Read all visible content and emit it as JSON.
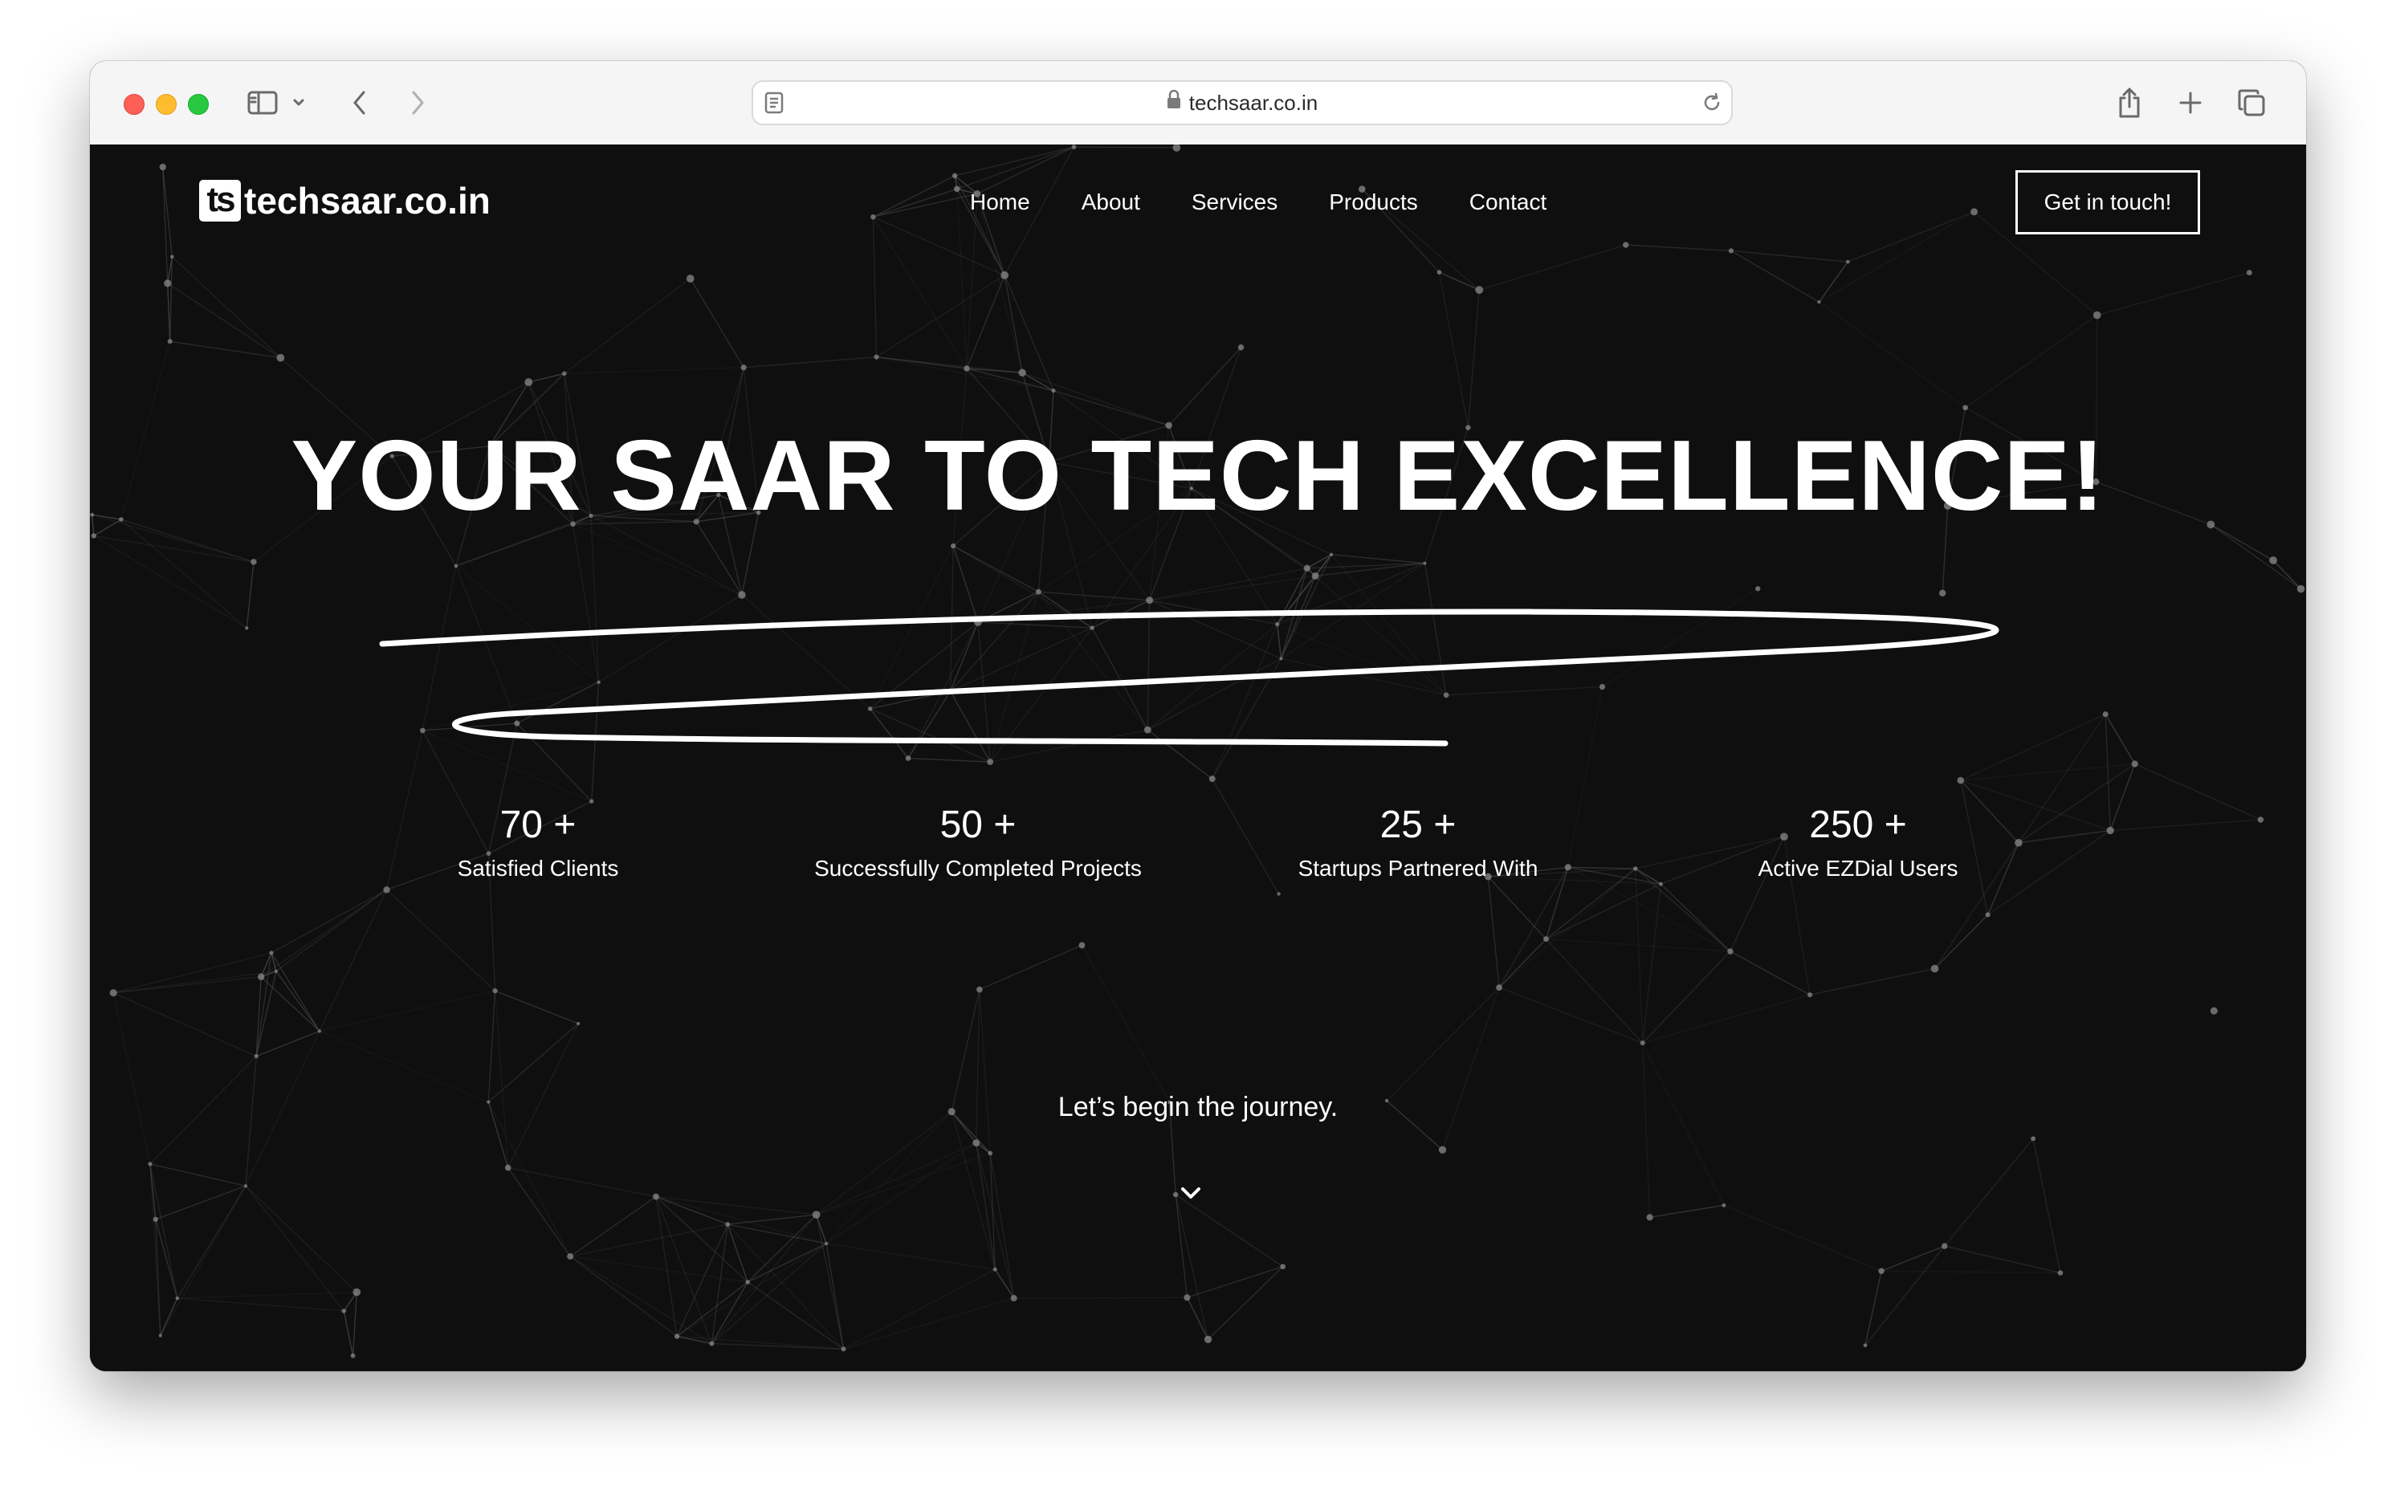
{
  "browser": {
    "url": "techsaar.co.in"
  },
  "site": {
    "logo_badge": "ts",
    "logo_text": "techsaar.co.in",
    "nav": [
      "Home",
      "About",
      "Services",
      "Products",
      "Contact"
    ],
    "cta_label": "Get in touch!"
  },
  "hero": {
    "title": "YOUR SAAR TO TECH EXCELLENCE!"
  },
  "stats": [
    {
      "value": "70 +",
      "label": "Satisfied Clients"
    },
    {
      "value": "50 +",
      "label": "Successfully Completed Projects"
    },
    {
      "value": "25 +",
      "label": "Startups Partnered With"
    },
    {
      "value": "250 +",
      "label": "Active EZDial Users"
    }
  ],
  "journey_text": "Let’s begin the journey.",
  "icons": {
    "sidebar": "sidebar-icon",
    "back": "chevron-left-icon",
    "forward": "chevron-right-icon",
    "reader": "reader-icon",
    "lock": "lock-icon",
    "reload": "reload-icon",
    "share": "share-icon",
    "new_tab": "plus-icon",
    "tabs": "tabs-overview-icon",
    "scroll_down": "chevron-down-icon"
  },
  "colors": {
    "page_background": "#0f0f10",
    "text": "#ffffff",
    "network_lines": "#4a4a4a",
    "network_nodes": "#8a8a8a"
  }
}
